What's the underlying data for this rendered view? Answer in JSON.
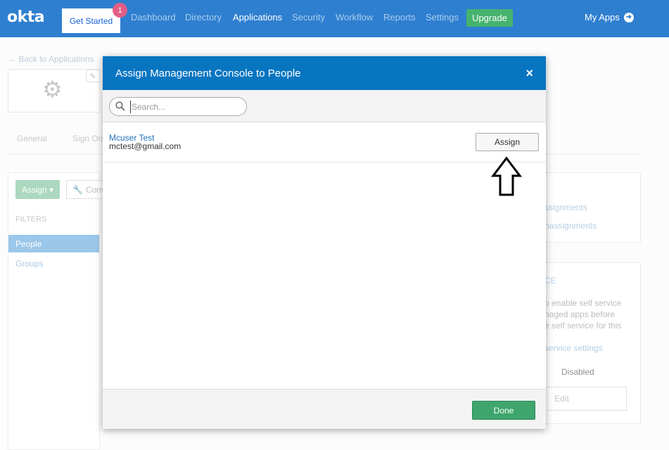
{
  "nav": {
    "logo": "okta",
    "get_started": "Get Started",
    "badge_count": "1",
    "items": [
      {
        "label": "Dashboard"
      },
      {
        "label": "Directory"
      },
      {
        "label": "Applications"
      },
      {
        "label": "Security"
      },
      {
        "label": "Workflow"
      },
      {
        "label": "Reports"
      },
      {
        "label": "Settings"
      }
    ],
    "active_item": "Applications",
    "upgrade": "Upgrade",
    "my_apps": "My Apps"
  },
  "page": {
    "back_link": "← Back to Applications",
    "tabs": [
      {
        "label": "General"
      },
      {
        "label": "Sign On"
      }
    ],
    "assign_button": "Assign ▾",
    "convert_button": "Conv",
    "filters_heading": "FILTERS",
    "filters": [
      {
        "label": "People"
      },
      {
        "label": "Groups"
      }
    ],
    "right_panel": {
      "link1": "ssignments",
      "link2": "nassignments",
      "section_heading": "CE",
      "text_lines": [
        "o enable self service",
        "naged apps before",
        "e self service for this"
      ],
      "settings_link": "service settings",
      "status": "Disabled",
      "edit_button": "Edit"
    }
  },
  "modal": {
    "title": "Assign Management Console to People",
    "close_icon": "×",
    "search": {
      "placeholder": "Search..."
    },
    "users": [
      {
        "name": "Mcuser Test",
        "email": "mctest@gmail.com",
        "action": "Assign"
      }
    ],
    "done_button": "Done"
  },
  "colors": {
    "nav_bg": "#2f7fd0",
    "modal_header": "#0875c1",
    "done_green": "#3ea56c",
    "upgrade_green": "#45b36e",
    "badge_pink": "#e35e86"
  }
}
